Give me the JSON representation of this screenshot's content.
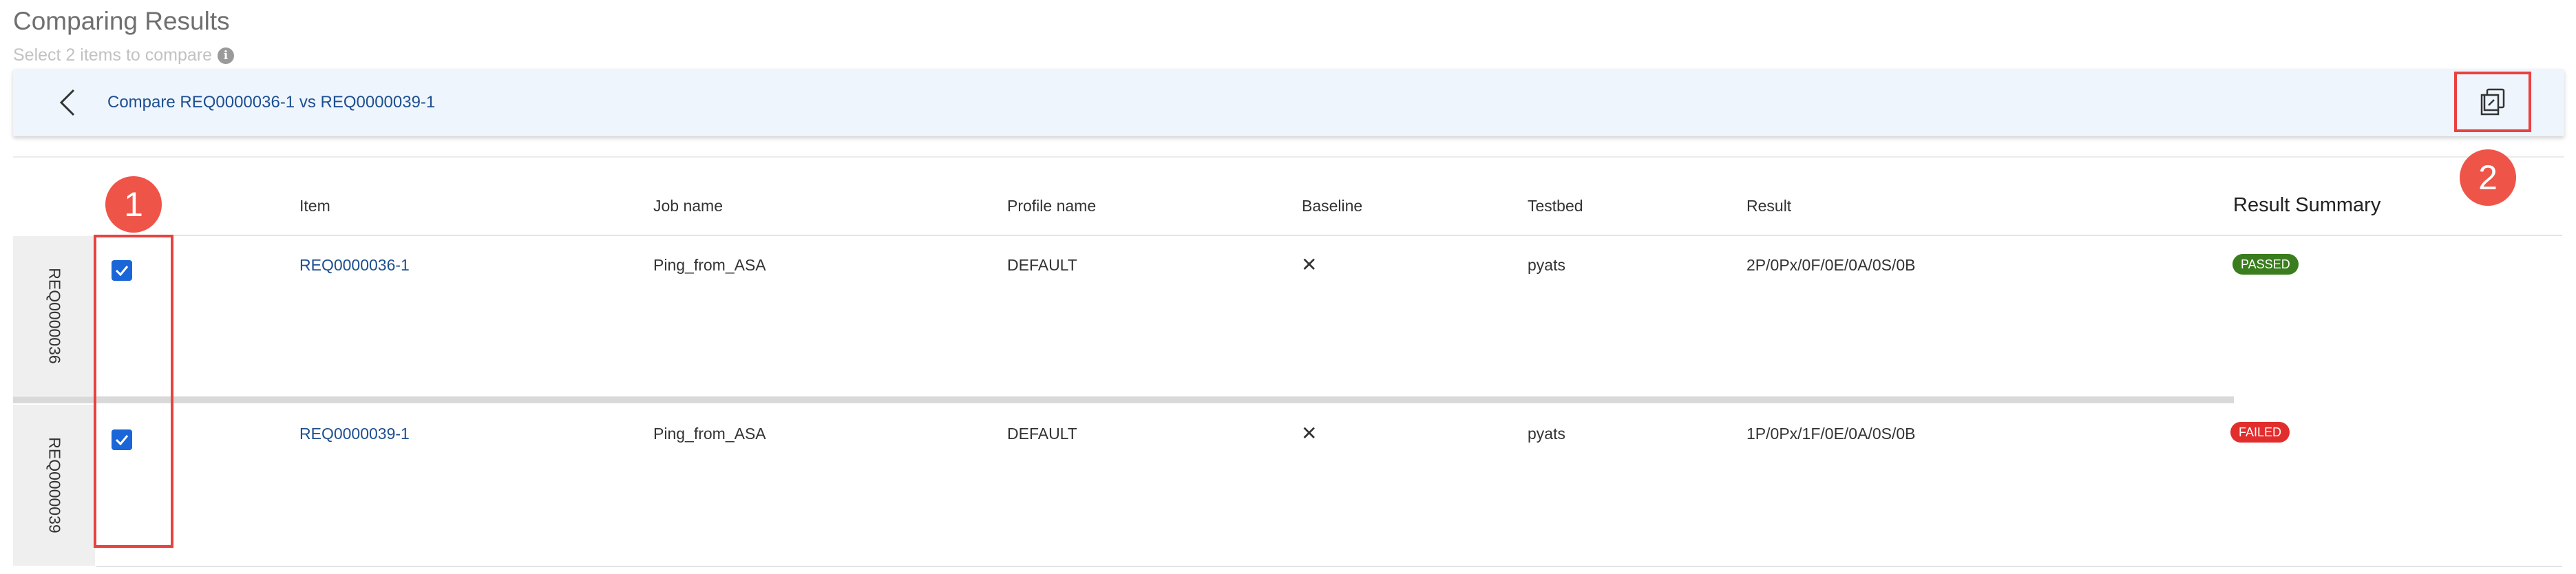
{
  "page": {
    "title": "Comparing Results",
    "subtitle": "Select 2 items to compare",
    "info_icon_glyph": "i"
  },
  "compare_bar": {
    "title": "Compare REQ0000036-1 vs REQ0000039-1",
    "back_icon": "chevron-left-icon",
    "copy_icon": "copy-icon"
  },
  "annotations": {
    "marker_1": "1",
    "marker_2": "2",
    "highlight_color": "#e8423f"
  },
  "table": {
    "columns": {
      "item": "Item",
      "job_name": "Job name",
      "profile_name": "Profile name",
      "baseline": "Baseline",
      "testbed": "Testbed",
      "result": "Result",
      "result_summary": "Result Summary"
    },
    "rows": [
      {
        "group": "REQ0000036",
        "checked": true,
        "item": "REQ0000036-1",
        "job_name": "Ping_from_ASA",
        "profile_name": "DEFAULT",
        "baseline": "✕",
        "testbed": "pyats",
        "result": "2P/0Px/0F/0E/0A/0S/0B",
        "status": "PASSED",
        "status_color": "#3b7d1e"
      },
      {
        "group": "REQ0000039",
        "checked": true,
        "item": "REQ0000039-1",
        "job_name": "Ping_from_ASA",
        "profile_name": "DEFAULT",
        "baseline": "✕",
        "testbed": "pyats",
        "result": "1P/0Px/1F/0E/0A/0S/0B",
        "status": "FAILED",
        "status_color": "#e22d2d"
      }
    ]
  },
  "colors": {
    "accent": "#1a66d9",
    "link": "#1d4f91",
    "bar_background": "#eef5fd"
  }
}
